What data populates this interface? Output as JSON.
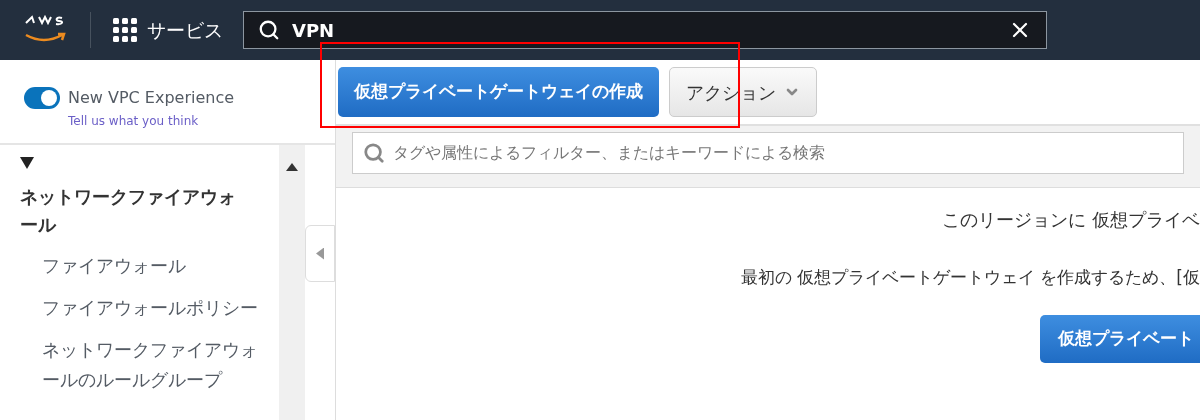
{
  "header": {
    "services_label": "サービス",
    "search": {
      "value": "VPN"
    }
  },
  "sidebar": {
    "toggle": {
      "label": "New VPC Experience",
      "on": true
    },
    "feedback_link": "Tell us what you think",
    "section": {
      "title": "ネットワークファイアウォール",
      "expanded": true,
      "items": [
        {
          "label": "ファイアウォール"
        },
        {
          "label": "ファイアウォールポリシー"
        },
        {
          "label": "ネットワークファイアウォールのルールグループ"
        }
      ]
    }
  },
  "toolbar": {
    "create_button": "仮想プライベートゲートウェイの作成",
    "actions_button": "アクション",
    "highlighted": true
  },
  "filter": {
    "placeholder": "タグや属性によるフィルター、またはキーワードによる検索"
  },
  "empty_state": {
    "message": "このリージョンに 仮想プライベ",
    "instruction": "最初の 仮想プライベートゲートウェイ を作成するため、[仮",
    "button": "仮想プライベート"
  }
}
